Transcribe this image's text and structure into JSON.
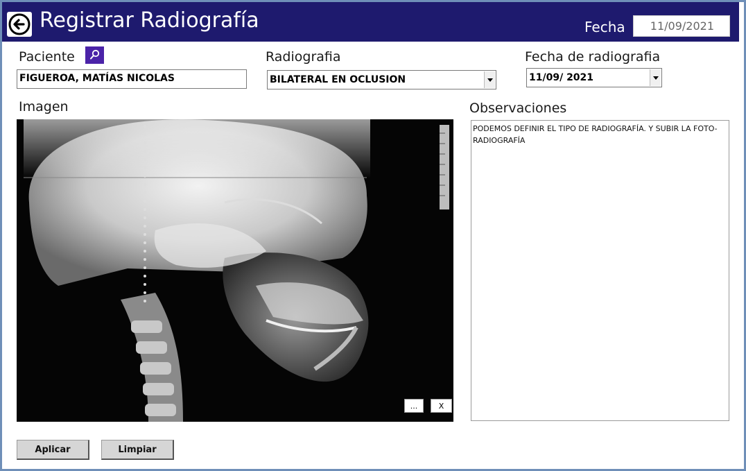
{
  "header": {
    "title": "Registrar Radiografía",
    "fecha_label": "Fecha",
    "fecha_value": "11/09/2021"
  },
  "form": {
    "paciente_label": "Paciente",
    "paciente_value": "FIGUEROA, MATÍAS NICOLAS",
    "radiografia_label": "Radiografia",
    "radiografia_value": "BILATERAL EN OCLUSION",
    "fecha_radiografia_label": "Fecha de radiografia",
    "fecha_radiografia_value": "11/09/ 2021",
    "imagen_label": "Imagen",
    "observaciones_label": "Observaciones",
    "observaciones_value": "PODEMOS DEFINIR EL TIPO DE RADIOGRAFÍA. Y SUBIR LA FOTO-RADIOGRAFÍA"
  },
  "image_controls": {
    "browse_label": "...",
    "clear_label": "X"
  },
  "actions": {
    "apply_label": "Aplicar",
    "clear_label": "Limpiar"
  },
  "icons": {
    "back": "back-arrow-icon",
    "search": "search-icon",
    "dropdown": "chevron-down-icon"
  },
  "colors": {
    "header_bg": "#1e1a6e",
    "search_btn": "#4b23a8",
    "frame_border": "#6f8fb8"
  }
}
